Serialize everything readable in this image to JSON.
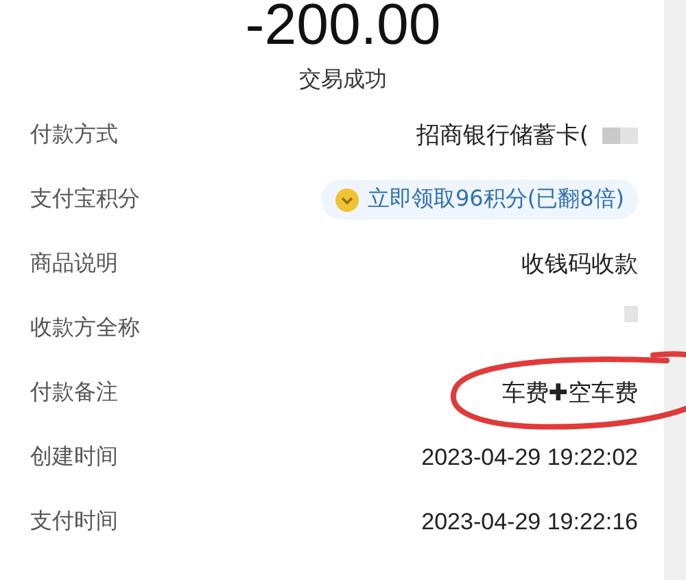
{
  "amount": "-200.00",
  "status": "交易成功",
  "rows": [
    {
      "label": "付款方式",
      "kind": "text",
      "value": "招商银行储蓄卡(",
      "redacted": true,
      "circled": false
    },
    {
      "label": "支付宝积分",
      "kind": "badge",
      "value": "立即领取96积分(已翻8倍)",
      "redacted": false,
      "circled": false
    },
    {
      "label": "商品说明",
      "kind": "text",
      "value": "收钱码收款",
      "redacted": false,
      "circled": false
    },
    {
      "label": "收款方全称",
      "kind": "text",
      "redacted": true,
      "circled": false
    },
    {
      "label": "付款备注",
      "kind": "text",
      "value": "车费✚空车费",
      "redacted": false,
      "circled": true
    },
    {
      "label": "创建时间",
      "kind": "text",
      "value": "2023-04-29 19:22:02",
      "redacted": false,
      "circled": false
    },
    {
      "label": "支付时间",
      "kind": "text",
      "value": "2023-04-29 19:22:16",
      "redacted": false,
      "circled": false
    }
  ]
}
